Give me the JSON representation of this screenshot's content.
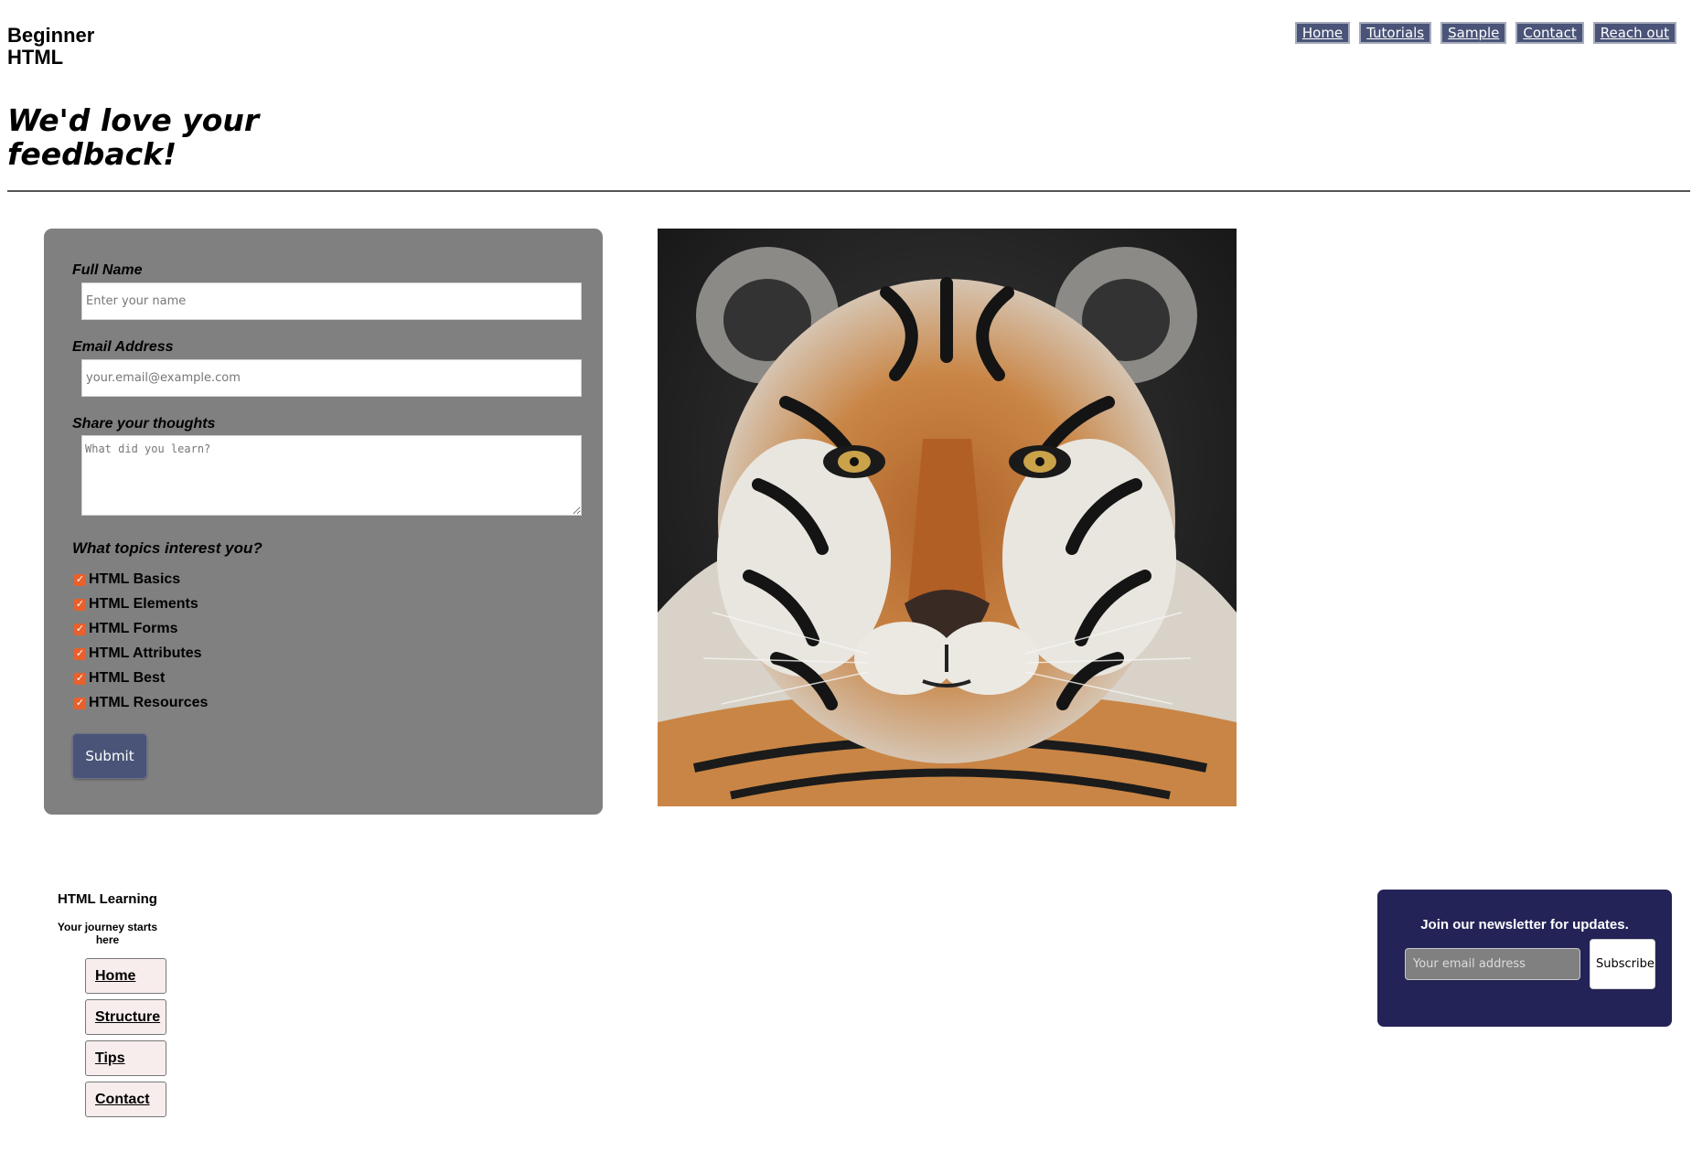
{
  "header": {
    "site_title": "Beginner HTML",
    "nav": [
      {
        "label": "Home"
      },
      {
        "label": "Tutorials"
      },
      {
        "label": "Sample"
      },
      {
        "label": "Contact"
      },
      {
        "label": "Reach out"
      }
    ],
    "heading": "We'd love your feedback!"
  },
  "form": {
    "name_label": "Full Name",
    "name_placeholder": "Enter your name",
    "email_label": "Email Address",
    "email_placeholder": "your.email@example.com",
    "thoughts_label": "Share your thoughts",
    "thoughts_placeholder": "What did you learn?",
    "topics_title": "What topics interest you?",
    "topics": [
      {
        "label": "HTML Basics",
        "checked": true
      },
      {
        "label": "HTML Elements",
        "checked": true
      },
      {
        "label": "HTML Forms",
        "checked": true
      },
      {
        "label": "HTML Attributes",
        "checked": true
      },
      {
        "label": "HTML Best",
        "checked": true
      },
      {
        "label": "HTML Resources",
        "checked": true
      }
    ],
    "submit_label": "Submit"
  },
  "footer": {
    "brand": "HTML Learning",
    "tagline": "Your journey starts here",
    "links": [
      {
        "label": "Home"
      },
      {
        "label": "Structure"
      },
      {
        "label": "Tips"
      },
      {
        "label": "Contact"
      }
    ],
    "newsletter": {
      "heading": "Join our newsletter for updates.",
      "email_placeholder": "Your email address",
      "subscribe_label": "Subscribe"
    }
  },
  "colors": {
    "nav_button": "#4a5478",
    "form_card": "#808080",
    "checkbox": "#e8602c",
    "newsletter_card": "#232357"
  }
}
